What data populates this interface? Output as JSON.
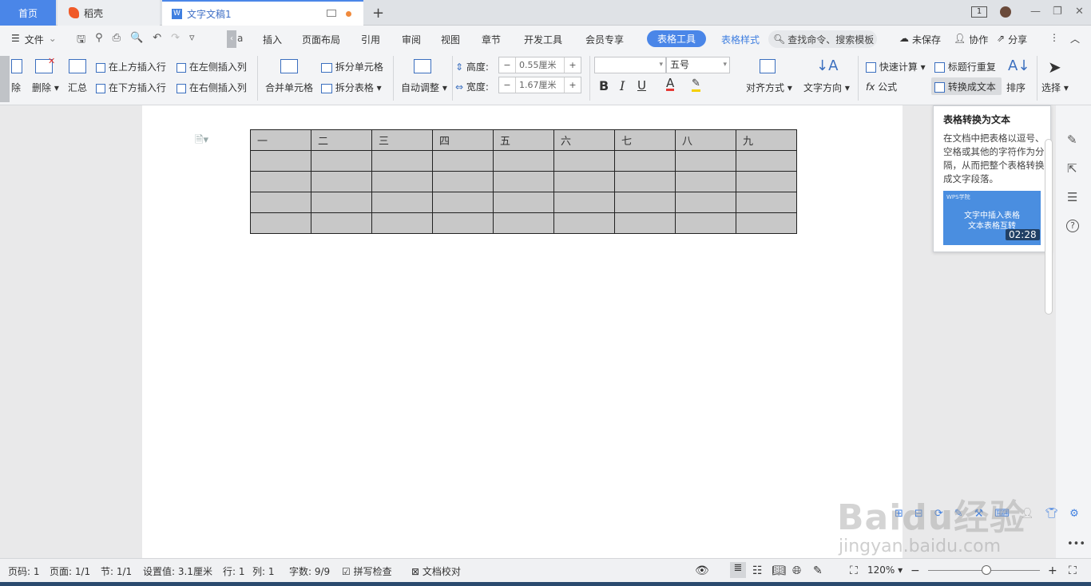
{
  "tabs": {
    "home": "首页",
    "daoke": "稻壳",
    "doc": "文字文稿1",
    "page_badge": "1"
  },
  "menu": {
    "file": "文件",
    "items": [
      "插入",
      "页面布局",
      "引用",
      "审阅",
      "视图",
      "章节",
      "开发工具",
      "会员专享"
    ],
    "table_tools": "表格工具",
    "table_style": "表格样式",
    "search": "查找命令、搜索模板",
    "unsaved": "未保存",
    "collab": "协作",
    "share": "分享"
  },
  "ribbon": {
    "delete_frag": "除",
    "delete": "删除",
    "summary": "汇总",
    "insert_above": "在上方插入行",
    "insert_below": "在下方插入行",
    "insert_left": "在左侧插入列",
    "insert_right": "在右侧插入列",
    "merge": "合并单元格",
    "split_cell": "拆分单元格",
    "split_table": "拆分表格",
    "auto_adjust": "自动调整",
    "height_label": "高度:",
    "height_value": "0.55厘米",
    "width_label": "宽度:",
    "width_value": "1.67厘米",
    "font_size": "五号",
    "align": "对齐方式",
    "text_dir": "文字方向",
    "quick_calc": "快速计算",
    "formula": "公式",
    "repeat_header": "标题行重复",
    "to_text": "转换成文本",
    "sort": "排序",
    "select": "选择"
  },
  "table": {
    "header": [
      "一",
      "二",
      "三",
      "四",
      "五",
      "六",
      "七",
      "八",
      "九"
    ],
    "rows": 4
  },
  "tooltip": {
    "title": "表格转换为文本",
    "desc": "在文档中把表格以逗号、空格或其他的字符作为分隔，从而把整个表格转换成文字段落。",
    "video_brand": "WPS学院",
    "video_title1": "文字中插入表格",
    "video_title2": "文本表格互转",
    "video_time": "02:28"
  },
  "status": {
    "page": "页码: 1",
    "pages": "页面: 1/1",
    "section": "节: 1/1",
    "setting": "设置值: 3.1厘米",
    "row": "行: 1",
    "col": "列: 1",
    "words": "字数: 9/9",
    "spell": "拼写检查",
    "proof": "文档校对",
    "zoom": "120%"
  },
  "watermark": {
    "text": "Baidu经验",
    "url": "jingyan.baidu.com"
  }
}
